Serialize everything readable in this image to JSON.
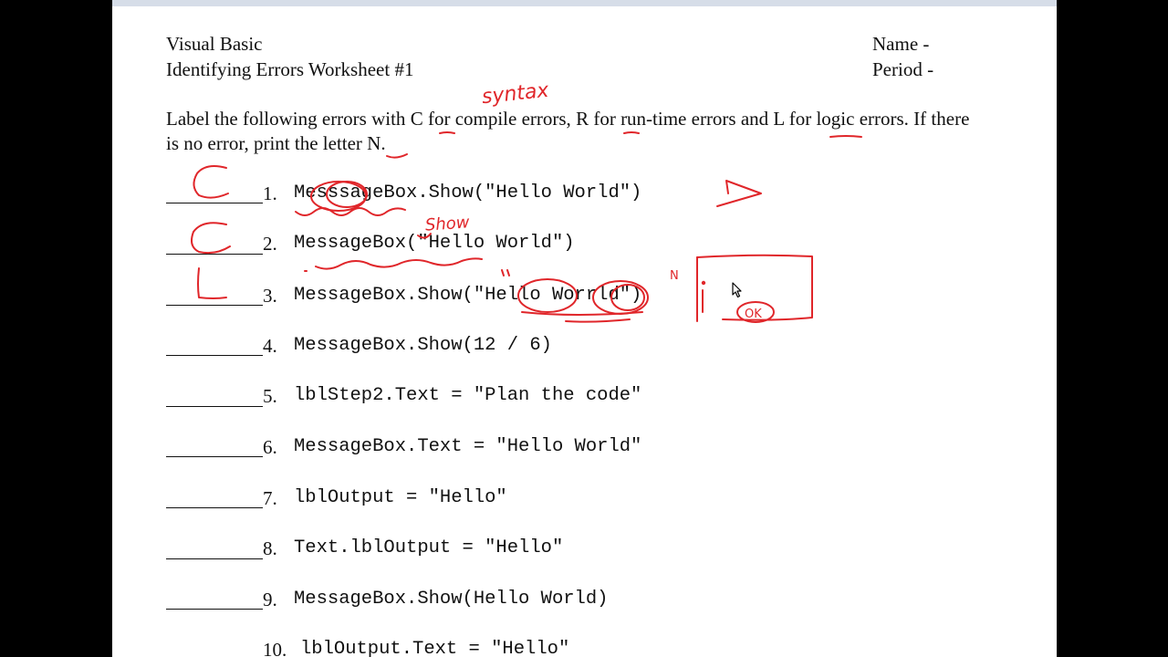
{
  "header": {
    "course": "Visual Basic",
    "title": "Identifying Errors Worksheet #1",
    "name_label": "Name -",
    "period_label": "Period -"
  },
  "instructions": {
    "line1_a": "Label the following errors with ",
    "line1_c": "C",
    "line1_b": " for compile errors, ",
    "line1_r": "R",
    "line1_d": " for run-time errors and ",
    "line1_l": "L",
    "line1_e": " for logic errors. If there",
    "line2_a": "is no error, print the letter ",
    "line2_n": "N",
    "line2_b": "."
  },
  "questions": [
    {
      "number": "1.",
      "code": "Messsage Box.Show(\"Hello World\")"
    },
    {
      "number": "2.",
      "code": "MessageBox(\"Hello World\")"
    },
    {
      "number": "3.",
      "code": "MessageBox.Show(\"Hello Worrld\")"
    },
    {
      "number": "4.",
      "code": "MessageBox.Show(12 / 6)"
    },
    {
      "number": "5.",
      "code": "lblStep2.Text = \"Plan the code\""
    },
    {
      "number": "6.",
      "code": "MessageBox.Text = \"Hello World\""
    },
    {
      "number": "7.",
      "code": "lblOutput = \"Hello\""
    },
    {
      "number": "8.",
      "code": "Text.lblOutput = \"Hello\""
    },
    {
      "number": "9.",
      "code": "MessageBox.Show(Hello World)"
    },
    {
      "number": "10.",
      "code": "lblOutput.Text = \"Hello\""
    }
  ],
  "annotations": {
    "syntax_note": "syntax",
    "show_note": "Show",
    "answer_1": "C",
    "answer_2": "C",
    "answer_3": "L",
    "n_mark": "N",
    "ok_button": "OK",
    "ink_color": "#e0262a"
  }
}
